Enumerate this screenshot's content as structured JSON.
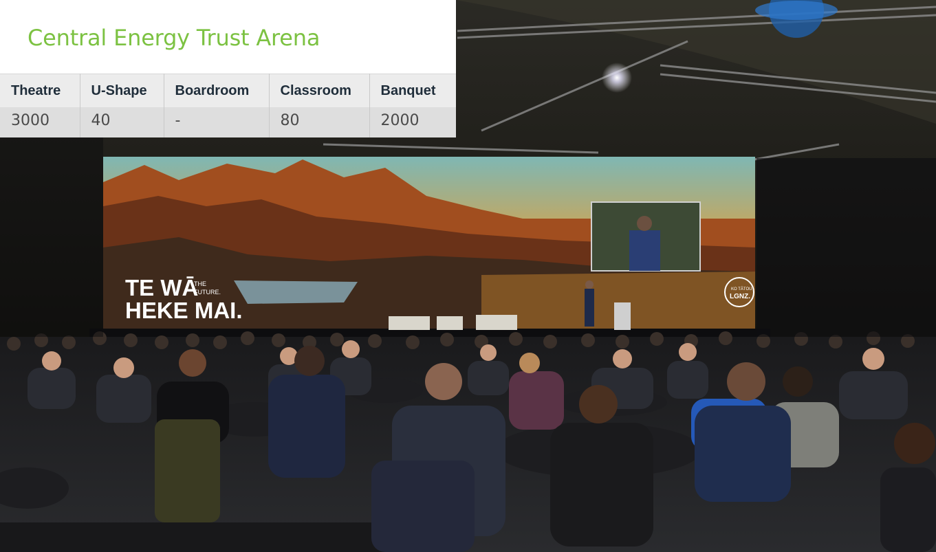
{
  "venue": {
    "title": "Central Energy Trust Arena"
  },
  "capacity": {
    "columns": [
      "Theatre",
      "U-Shape",
      "Boardroom",
      "Classroom",
      "Banquet"
    ],
    "values": [
      "3000",
      "40",
      "-",
      "80",
      "2000"
    ]
  },
  "screen": {
    "headline_line1": "TE WĀ",
    "headline_tag1": "THE",
    "headline_tag2": "FUTURE.",
    "headline_line2": "HEKE MAI.",
    "badge_line1": "KO TĀTOU",
    "badge_line2": "LGNZ."
  },
  "colors": {
    "accent": "#7cc242",
    "header_bg": "#ececec",
    "value_bg": "#dedede"
  }
}
